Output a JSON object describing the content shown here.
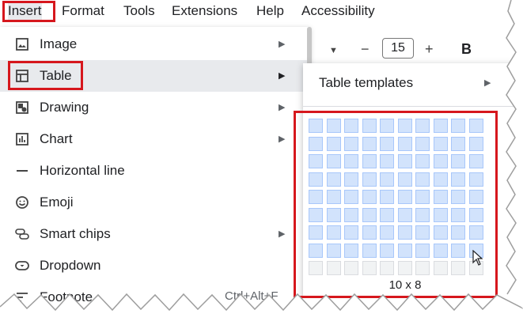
{
  "menubar": {
    "items": [
      "Insert",
      "Format",
      "Tools",
      "Extensions",
      "Help",
      "Accessibility"
    ]
  },
  "toolbar": {
    "font_size": "15",
    "minus": "−",
    "plus": "+",
    "bold": "B"
  },
  "menu": {
    "items": [
      {
        "label": "Image",
        "icon": "image-icon",
        "submenu": true
      },
      {
        "label": "Table",
        "icon": "table-icon",
        "submenu": true
      },
      {
        "label": "Drawing",
        "icon": "drawing-icon",
        "submenu": true
      },
      {
        "label": "Chart",
        "icon": "chart-icon",
        "submenu": true
      },
      {
        "label": "Horizontal line",
        "icon": "horizontal-line-icon",
        "submenu": false
      },
      {
        "label": "Emoji",
        "icon": "emoji-icon",
        "submenu": false
      },
      {
        "label": "Smart chips",
        "icon": "smart-chips-icon",
        "submenu": true
      },
      {
        "label": "Dropdown",
        "icon": "dropdown-icon",
        "submenu": false
      },
      {
        "label": "Footnote",
        "icon": "footnote-icon",
        "submenu": false,
        "shortcut": "Ctrl+Alt+F"
      }
    ]
  },
  "submenu": {
    "table_templates": "Table templates",
    "grid_columns": 10,
    "grid_rows": 9,
    "selected_columns": 10,
    "selected_rows": 8,
    "dimensions": "10 x 8"
  },
  "colors": {
    "highlight_box": "#d6171d",
    "selected_cell": "#d2e3fc",
    "menu_hover": "#e8eaed"
  }
}
